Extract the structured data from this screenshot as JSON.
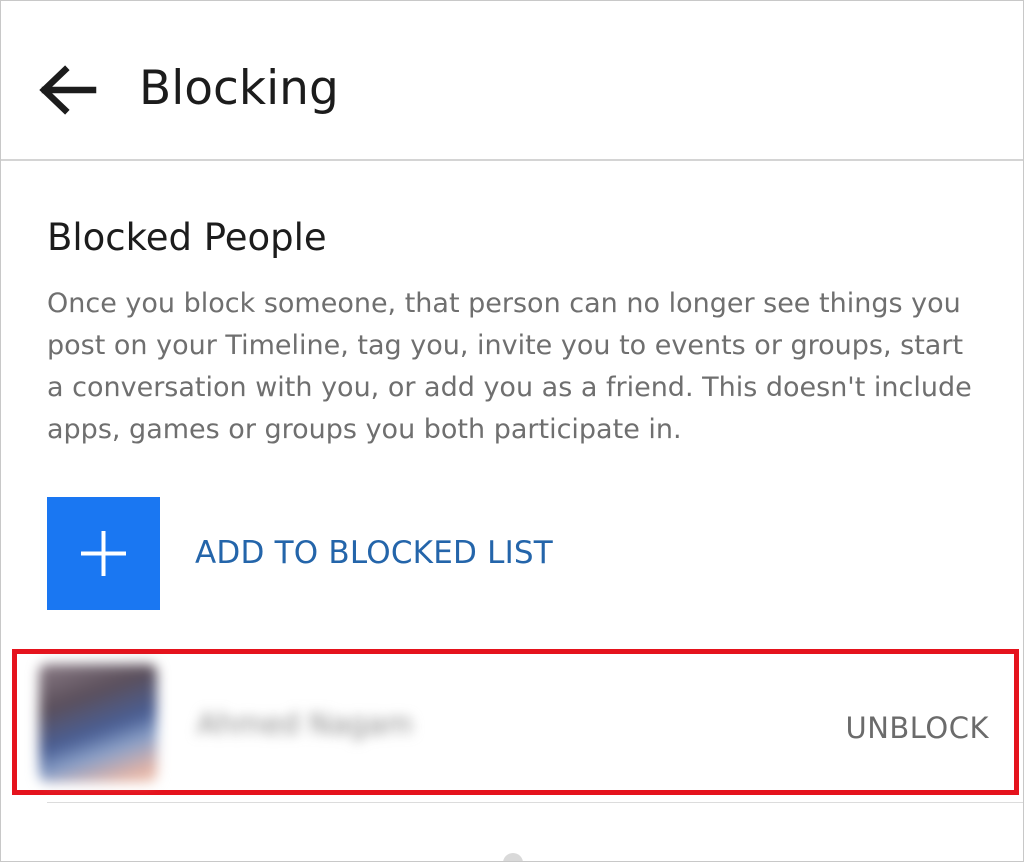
{
  "header": {
    "title": "Blocking",
    "back_icon": "arrow-left-icon"
  },
  "blocked_people": {
    "title": "Blocked People",
    "description": "Once you block someone, that person can no longer see things you post on your Timeline, tag you, invite you to events or groups, start a conversation with you, or add you as a friend. This doesn't include apps, games or groups you both participate in.",
    "add_button": {
      "icon": "plus-icon",
      "label": "ADD TO BLOCKED LIST",
      "icon_bg_color": "#1a77f2",
      "label_color": "#2465aa"
    },
    "items": [
      {
        "name": "Ahmed Nagam",
        "action_label": "UNBLOCK",
        "highlight_color": "#e5131d"
      }
    ]
  }
}
